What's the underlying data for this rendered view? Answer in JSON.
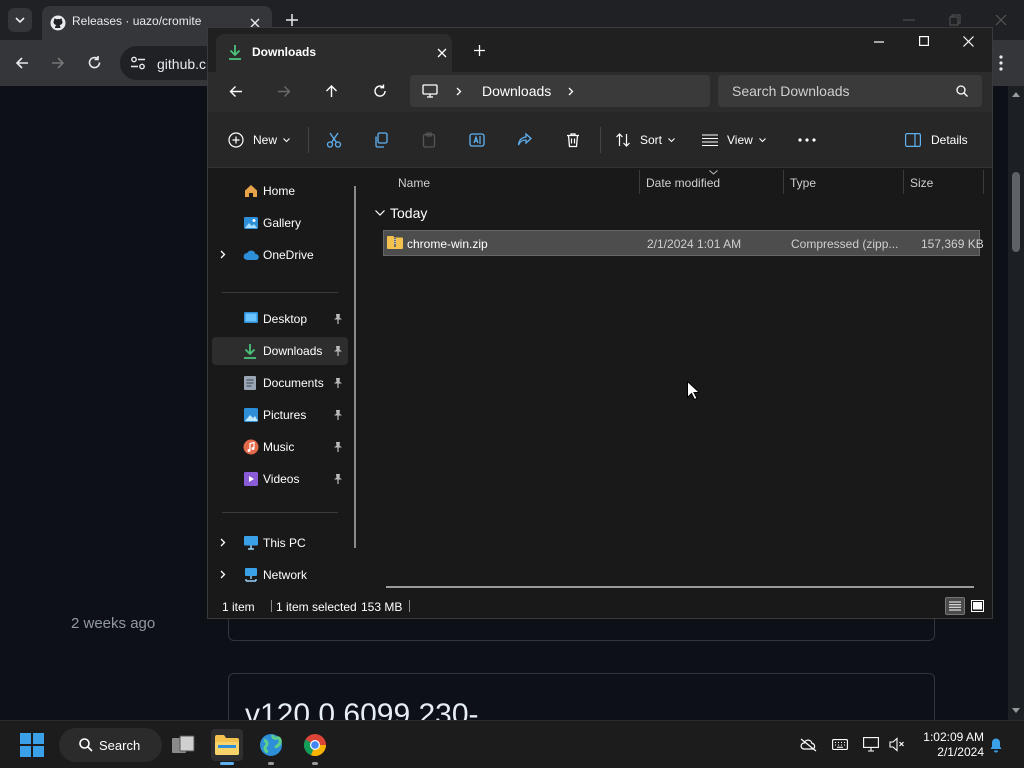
{
  "browser": {
    "tab_title": "Releases · uazo/cromite",
    "url_partial": "github.c",
    "page_version_heading": "v120.0.6099.230-",
    "page_time": "2 weeks ago"
  },
  "explorer": {
    "tab_title": "Downloads",
    "breadcrumb": [
      "Downloads"
    ],
    "search_placeholder": "Search Downloads",
    "commands": {
      "new": "New",
      "sort": "Sort",
      "view": "View",
      "details": "Details"
    },
    "nav": {
      "home": "Home",
      "gallery": "Gallery",
      "onedrive": "OneDrive",
      "desktop": "Desktop",
      "downloads": "Downloads",
      "documents": "Documents",
      "pictures": "Pictures",
      "music": "Music",
      "videos": "Videos",
      "thispc": "This PC",
      "network": "Network"
    },
    "columns": {
      "name": "Name",
      "date": "Date modified",
      "type": "Type",
      "size": "Size"
    },
    "group": "Today",
    "file": {
      "name": "chrome-win.zip",
      "date": "2/1/2024 1:01 AM",
      "type": "Compressed (zipp...",
      "size": "157,369 KB"
    },
    "status": {
      "count": "1 item",
      "selected": "1 item selected",
      "size": "153 MB"
    }
  },
  "taskbar": {
    "search_label": "Search",
    "time": "1:02:09 AM",
    "date": "2/1/2024"
  },
  "colors": {
    "downloads_green": "#4cc27a",
    "chrome_dark": "#202124",
    "explorer_bg": "#191919",
    "selection": "#4d4d4d"
  }
}
